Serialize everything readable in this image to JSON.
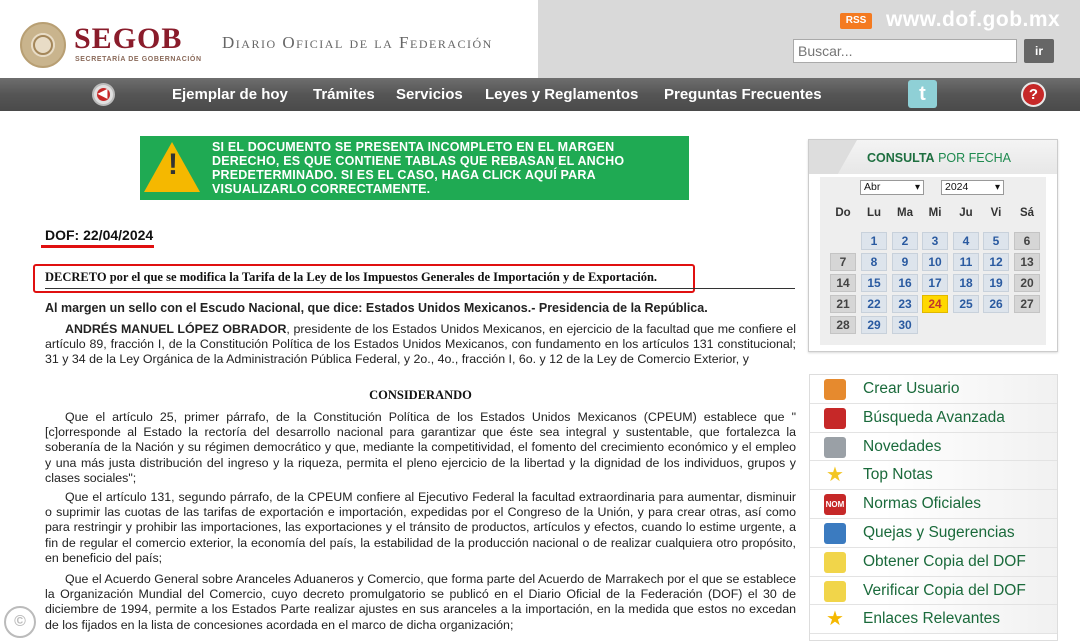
{
  "header": {
    "brand": "SEGOB",
    "brand_sub": "SECRETARÍA DE GOBERNACIÓN",
    "title": "Diario Oficial de la Federación",
    "rss": "RSS",
    "site_url": "www.dof.gob.mx",
    "search_placeholder": "Buscar...",
    "search_button": "ir"
  },
  "nav": {
    "items": [
      "Ejemplar de hoy",
      "Trámites",
      "Servicios",
      "Leyes y Reglamentos",
      "Preguntas Frecuentes"
    ],
    "help": "?"
  },
  "notice": {
    "text": "SI EL DOCUMENTO SE PRESENTA INCOMPLETO EN EL MARGEN DERECHO, ES QUE CONTIENE TABLAS QUE REBASAN EL ANCHO PREDETERMINADO. SI ES EL CASO, HAGA CLICK AQUÍ PARA VISUALIZARLO CORRECTAMENTE."
  },
  "document": {
    "dof_date": "DOF: 22/04/2024",
    "decree_title": "DECRETO por el que se modifica la Tarifa de la Ley de los Impuestos Generales de Importación y de Exportación.",
    "margin_line": "Al margen un sello con el Escudo Nacional, que dice: Estados Unidos Mexicanos.- Presidencia de la República.",
    "intro_name": "ANDRÉS MANUEL LÓPEZ OBRADOR",
    "intro_rest": ", presidente de los Estados Unidos Mexicanos, en ejercicio de la facultad que me confiere el artículo 89, fracción I, de la Constitución Política de los Estados Unidos Mexicanos, con fundamento en los artículos 131 constitucional; 31 y 34 de la Ley Orgánica de la Administración Pública Federal, y 2o., 4o., fracción I, 6o. y 12 de la Ley de Comercio Exterior, y",
    "heading": "CONSIDERANDO",
    "para1": "Que el artículo 25, primer párrafo, de la Constitución Política de los Estados Unidos Mexicanos (CPEUM) establece que \"[c]orresponde al Estado la rectoría del desarrollo nacional para garantizar que éste sea integral y sustentable, que fortalezca la soberanía de la Nación y su régimen democrático y que, mediante la competitividad, el fomento del crecimiento económico y el empleo y una más justa distribución del ingreso y la riqueza, permita el pleno ejercicio de la libertad y la dignidad de los individuos, grupos y clases sociales\";",
    "para2": "Que el artículo 131, segundo párrafo, de la CPEUM confiere al Ejecutivo Federal la facultad extraordinaria para aumentar, disminuir o suprimir las cuotas de las tarifas de exportación e importación, expedidas por el Congreso de la Unión, y para crear otras, así como para restringir y prohibir las importaciones, las exportaciones y el tránsito de productos, artículos y efectos, cuando lo estime urgente, a fin de regular el comercio exterior, la economía del país, la estabilidad de la producción nacional o de realizar cualquiera otro propósito, en beneficio del país;",
    "para3": "Que el Acuerdo General sobre Aranceles Aduaneros y Comercio, que forma parte del Acuerdo de Marrakech por el que se establece la Organización Mundial del Comercio, cuyo decreto promulgatorio se publicó en el Diario Oficial de la Federación (DOF) el 30 de diciembre de 1994, permite a los Estados Parte realizar ajustes en sus aranceles a la importación, en la medida que estos no excedan de los fijados en la lista de concesiones acordada en el marco de dicha organización;"
  },
  "calendar": {
    "title_bold": "CONSULTA",
    "title_rest": " POR FECHA",
    "month": "Abr",
    "year": "2024",
    "weekdays": [
      "Do",
      "Lu",
      "Ma",
      "Mi",
      "Ju",
      "Vi",
      "Sá"
    ],
    "weeks": [
      [
        "",
        "1",
        "2",
        "3",
        "4",
        "5",
        "6"
      ],
      [
        "7",
        "8",
        "9",
        "10",
        "11",
        "12",
        "13"
      ],
      [
        "14",
        "15",
        "16",
        "17",
        "18",
        "19",
        "20"
      ],
      [
        "21",
        "22",
        "23",
        "24",
        "25",
        "26",
        "27"
      ],
      [
        "28",
        "29",
        "30",
        "",
        "",
        "",
        ""
      ]
    ],
    "today": "24"
  },
  "menu": {
    "items": [
      {
        "label": "Crear Usuario",
        "icon": "user-add-icon",
        "color": "#e68a2e"
      },
      {
        "label": "Búsqueda Avanzada",
        "icon": "search-icon",
        "color": "#c62828"
      },
      {
        "label": "Novedades",
        "icon": "newspaper-icon",
        "color": "#9aa0a6"
      },
      {
        "label": "Top Notas",
        "icon": "star-icon",
        "color": "#f3c623"
      },
      {
        "label": "Normas Oficiales",
        "icon": "nom-icon",
        "color": "#c62828"
      },
      {
        "label": "Quejas y Sugerencias",
        "icon": "mailbox-icon",
        "color": "#3b7bc0"
      },
      {
        "label": "Obtener Copia del DOF",
        "icon": "document-icon",
        "color": "#f1d54a"
      },
      {
        "label": "Verificar Copia del DOF",
        "icon": "verify-document-icon",
        "color": "#f1d54a"
      },
      {
        "label": "Enlaces Relevantes",
        "icon": "star-icon",
        "color": "#f5b800"
      }
    ]
  }
}
